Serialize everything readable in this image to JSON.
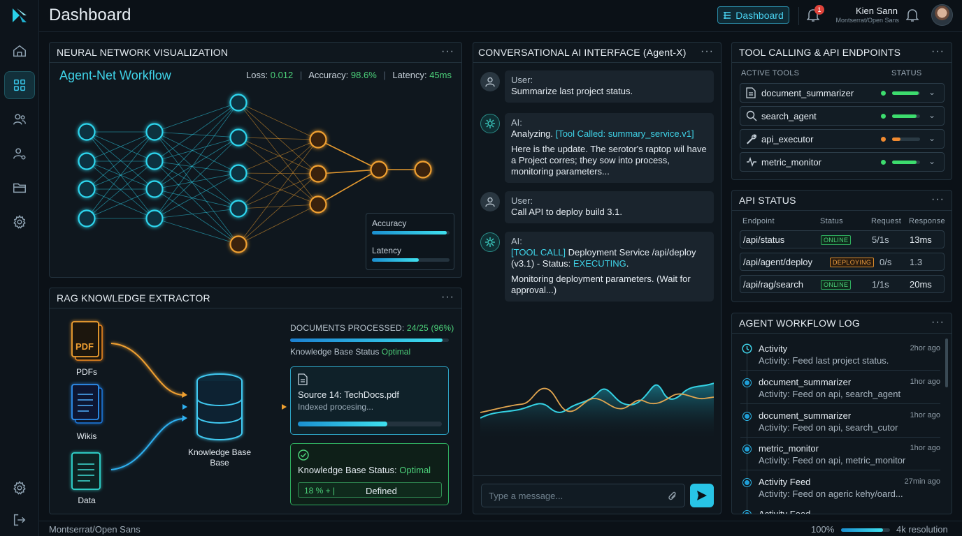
{
  "header": {
    "title": "Dashboard",
    "dashboard_button": "Dashboard",
    "notification_count": "1",
    "user_name": "Kien Sann",
    "user_sub": "Montserrat/Open Sans"
  },
  "sidebar": {
    "items": [
      {
        "icon": "home-icon"
      },
      {
        "icon": "grid-icon",
        "active": true
      },
      {
        "icon": "users-icon"
      },
      {
        "icon": "user-settings-icon"
      },
      {
        "icon": "folder-icon"
      },
      {
        "icon": "settings-icon"
      }
    ],
    "bottom": [
      {
        "icon": "settings-icon"
      },
      {
        "icon": "logout-icon"
      }
    ]
  },
  "neural": {
    "panel_title": "NEURAL NETWORK VISUALIZATION",
    "title": "Agent-Net Workflow",
    "loss_label": "Loss:",
    "loss_value": "0.012",
    "accuracy_label": "Accuracy:",
    "accuracy_value": "98.6%",
    "latency_label": "Latency:",
    "latency_value": "45ms",
    "legend_accuracy": "Accuracy",
    "legend_latency": "Latency",
    "legend_accuracy_fill": 0.96,
    "legend_latency_fill": 0.6,
    "colors": {
      "cyan": "#2fd6ee",
      "orange": "#f0a030"
    }
  },
  "rag": {
    "panel_title": "RAG KNOWLEDGE EXTRACTOR",
    "sources": [
      "PDFs",
      "Wikis",
      "Data"
    ],
    "pdf_icon_text": "PDF",
    "kb_label_1": "Knowledge Base",
    "kb_label_2": "Base",
    "docs_label": "DOCUMENTS PROCESSED:",
    "docs_value": "24/25 (96%)",
    "docs_fill": 0.96,
    "kb_status_label": "Knowledge Base Status",
    "kb_status_value": "Optimal",
    "source_title": "Source 14: TechDocs.pdf",
    "source_sub": "Indexed procesing...",
    "source_fill": 0.62,
    "ok_title_label": "Knowledge Base Status:",
    "ok_title_value": "Optimal",
    "ok_pct": "18 % + |",
    "ok_defined": "Defined"
  },
  "chat": {
    "panel_title": "CONVERSATIONAL AI INTERFACE (Agent-X)",
    "messages": [
      {
        "role": "User:",
        "text": "Summarize last project status."
      },
      {
        "role": "AI:",
        "pre": "Analyzing. ",
        "tool": "[Tool Called: summary_service.v1]",
        "text": "Here is the update. The serotor's raptop wil have a Project corres; they sow into process, monitoring parameters..."
      },
      {
        "role": "User:",
        "text": "Call API to deploy build 3.1."
      },
      {
        "role": "AI:",
        "tool": "[TOOL CALL]",
        "mid": " Deployment Service /api/deploy (v3.1) - Status: ",
        "status": "EXECUTING",
        "end": ".",
        "text": "Monitoring deployment parameters. (Wait for approval...)"
      }
    ],
    "input_placeholder": "Type a message..."
  },
  "tools": {
    "panel_title": "TOOL CALLING & API ENDPOINTS",
    "col_tools": "ACTIVE TOOLS",
    "col_status": "STATUS",
    "items": [
      {
        "name": "document_summarizer",
        "icon": "document-icon",
        "status_color": "#3ddc6e",
        "fill": 0.95
      },
      {
        "name": "search_agent",
        "icon": "search-icon",
        "status_color": "#3ddc6e",
        "fill": 0.88
      },
      {
        "name": "api_executor",
        "icon": "wrench-icon",
        "status_color": "#f08a30",
        "fill": 0.3
      },
      {
        "name": "metric_monitor",
        "icon": "pulse-icon",
        "status_color": "#3ddc6e",
        "fill": 0.88
      }
    ]
  },
  "api": {
    "panel_title": "API STATUS",
    "cols": [
      "Endpoint",
      "Status",
      "Request",
      "Response"
    ],
    "rows": [
      {
        "endpoint": "/api/status",
        "status": "ONLINE",
        "request": "5/1s",
        "response": "13ms"
      },
      {
        "endpoint": "/api/agent/deploy",
        "status": "DEPLOYING",
        "request": "0/s",
        "response": "1.3"
      },
      {
        "endpoint": "/api/rag/search",
        "status": "ONLINE",
        "request": "1/1s",
        "response": "20ms"
      }
    ]
  },
  "log": {
    "panel_title": "AGENT WORKFLOW LOG",
    "items": [
      {
        "name": "Activity",
        "time": "2hor ago",
        "desc": "Activity: Feed last project status."
      },
      {
        "name": "document_summarizer",
        "time": "1hor ago",
        "desc": "Activity: Feed on api, search_agent"
      },
      {
        "name": "document_summarizer",
        "time": "1hor ago",
        "desc": "Activity: Feed on api, search_cutor"
      },
      {
        "name": "metric_monitor",
        "time": "1hor ago",
        "desc": "Activity: Feed on api, metric_monitor"
      },
      {
        "name": "Activity Feed",
        "time": "27min ago",
        "desc": "Activity: Feed on ageric kehy/oard..."
      },
      {
        "name": "Activity Feed",
        "time": "",
        "desc": ""
      }
    ]
  },
  "footer": {
    "left": "Montserrat/Open Sans",
    "zoom": "100%",
    "zoom_fill": 0.85,
    "resolution": "4k resolution"
  }
}
